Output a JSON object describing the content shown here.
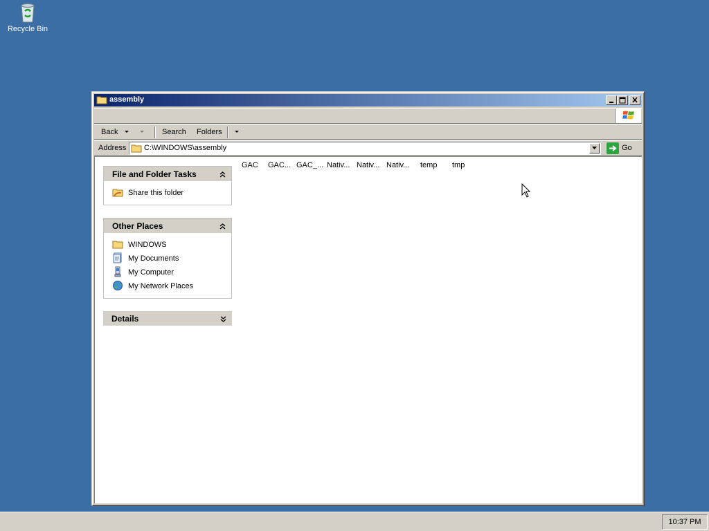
{
  "desktop": {
    "icons": [
      {
        "label": "Recycle Bin",
        "icon": "recycle-bin-icon"
      }
    ]
  },
  "window": {
    "title": "assembly",
    "colors": {
      "titlebar_start": "#0a246a",
      "titlebar_end": "#a6caf0",
      "desktop": "#3a6ea5"
    }
  },
  "toolbar": {
    "back_label": "Back",
    "search_label": "Search",
    "folders_label": "Folders"
  },
  "address": {
    "label": "Address",
    "value": "C:\\WINDOWS\\assembly",
    "go_label": "Go"
  },
  "tasks_panel": {
    "title": "File and Folder Tasks",
    "items": [
      {
        "label": "Share this folder",
        "icon": "share-folder-icon"
      }
    ]
  },
  "places_panel": {
    "title": "Other Places",
    "items": [
      {
        "label": "WINDOWS",
        "icon": "folder-icon"
      },
      {
        "label": "My Documents",
        "icon": "my-documents-icon"
      },
      {
        "label": "My Computer",
        "icon": "my-computer-icon"
      },
      {
        "label": "My Network Places",
        "icon": "network-places-icon"
      }
    ]
  },
  "details_panel": {
    "title": "Details"
  },
  "files": [
    "GAC",
    "GAC...",
    "GAC_...",
    "Nativ...",
    "Nativ...",
    "Nativ...",
    "temp",
    "tmp"
  ],
  "taskbar": {
    "clock": "10:37 PM"
  }
}
